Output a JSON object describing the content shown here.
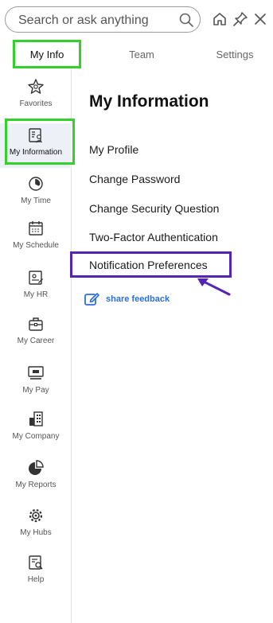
{
  "search": {
    "placeholder": "Search or ask anything"
  },
  "tabs": [
    {
      "label": "My Info",
      "active": true
    },
    {
      "label": "Team",
      "active": false
    },
    {
      "label": "Settings",
      "active": false
    }
  ],
  "sidebar": {
    "items": [
      {
        "label": "Favorites",
        "icon": "star-icon"
      },
      {
        "label": "My Information",
        "icon": "id-card-icon",
        "active": true
      },
      {
        "label": "My Time",
        "icon": "clock-icon"
      },
      {
        "label": "My Schedule",
        "icon": "calendar-icon"
      },
      {
        "label": "My HR",
        "icon": "hr-document-icon"
      },
      {
        "label": "My Career",
        "icon": "briefcase-icon"
      },
      {
        "label": "My Pay",
        "icon": "pay-monitor-icon"
      },
      {
        "label": "My Company",
        "icon": "building-icon"
      },
      {
        "label": "My Reports",
        "icon": "pie-chart-icon"
      },
      {
        "label": "My Hubs",
        "icon": "hub-gear-icon"
      },
      {
        "label": "Help",
        "icon": "help-book-icon"
      }
    ]
  },
  "main": {
    "title": "My Information",
    "links": [
      "My Profile",
      "Change Password",
      "Change Security Question",
      "Two-Factor Authentication",
      "Notification Preferences"
    ],
    "feedback_label": "share feedback"
  },
  "colors": {
    "highlight_green": "#33d12b",
    "highlight_purple": "#5424b5",
    "link_blue": "#2a6fdb"
  }
}
